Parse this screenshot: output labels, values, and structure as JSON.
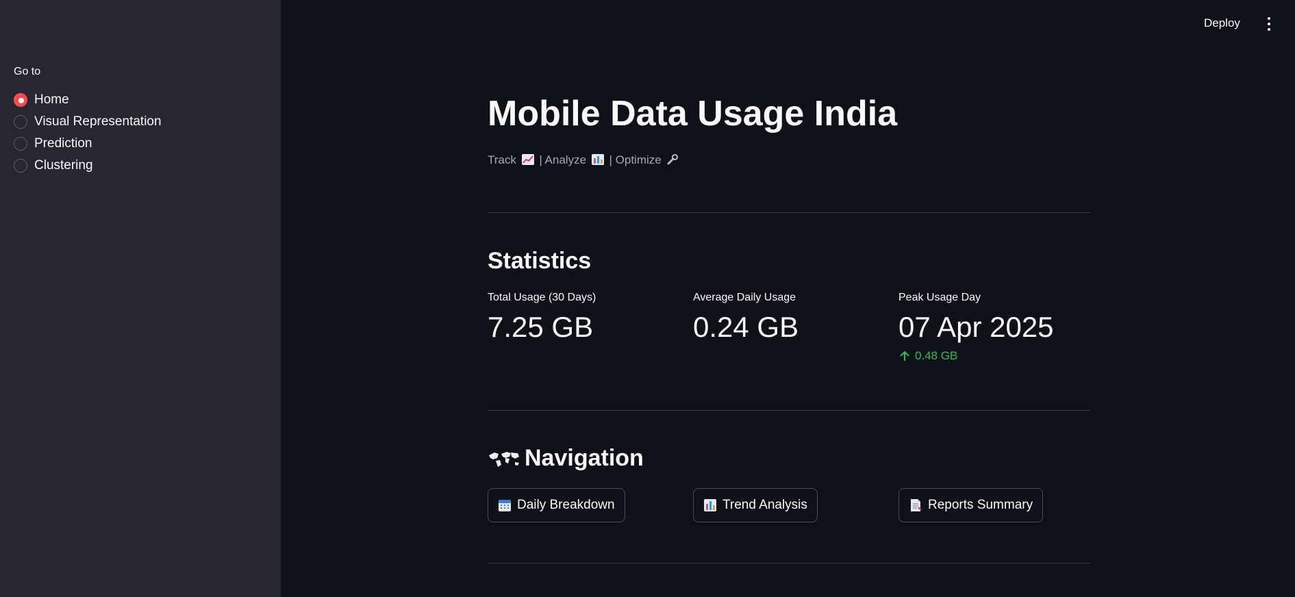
{
  "sidebar": {
    "label": "Go to",
    "options": [
      {
        "label": "Home",
        "selected": true
      },
      {
        "label": "Visual Representation",
        "selected": false
      },
      {
        "label": "Prediction",
        "selected": false
      },
      {
        "label": "Clustering",
        "selected": false
      }
    ]
  },
  "topbar": {
    "deploy_label": "Deploy",
    "menu_icon": "kebab-menu-icon"
  },
  "header": {
    "title": "Mobile Data Usage India",
    "subtitle_track": "Track",
    "subtitle_analyze": "| Analyze",
    "subtitle_optimize": "| Optimize",
    "subtitle_icons": [
      "chart-increasing-icon",
      "bar-chart-icon",
      "wrench-icon"
    ]
  },
  "statistics": {
    "heading": "Statistics",
    "metrics": [
      {
        "label": "Total Usage (30 Days)",
        "value": "7.25 GB"
      },
      {
        "label": "Average Daily Usage",
        "value": "0.24 GB"
      },
      {
        "label": "Peak Usage Day",
        "value": "07 Apr 2025",
        "delta": "0.48 GB",
        "delta_direction": "up"
      }
    ]
  },
  "navigation": {
    "heading": "Navigation",
    "heading_icon": "world-map-icon",
    "buttons": [
      {
        "label": "Daily Breakdown",
        "icon": "calendar-icon"
      },
      {
        "label": "Trend Analysis",
        "icon": "bar-chart-icon"
      },
      {
        "label": "Reports Summary",
        "icon": "document-icon"
      }
    ]
  },
  "colors": {
    "accent": "#ff4b4b",
    "background": "#0e1117",
    "sidebar": "#262730",
    "delta_positive": "#21c354"
  }
}
